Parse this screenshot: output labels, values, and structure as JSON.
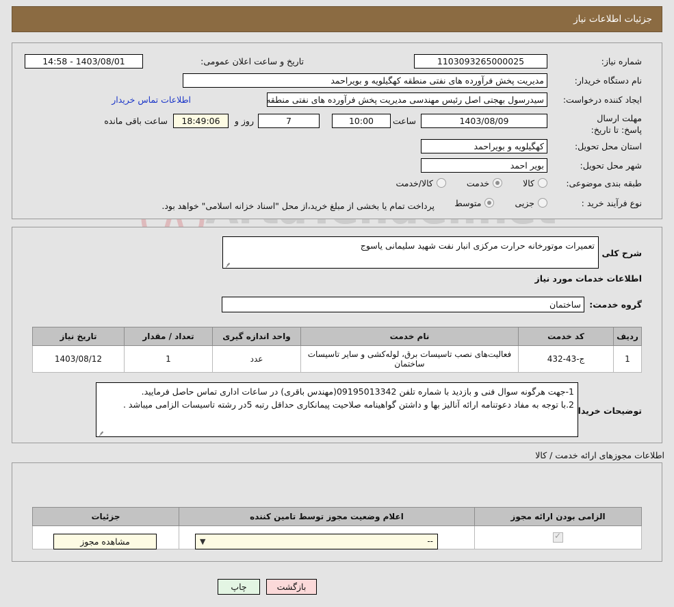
{
  "header": {
    "title": "جزئیات اطلاعات نیاز"
  },
  "watermark": {
    "text": "ArtaTender.net"
  },
  "form": {
    "need_number_label": "شماره نیاز:",
    "need_number_value": "1103093265000025",
    "announce_datetime_label": "تاریخ و ساعت اعلان عمومی:",
    "announce_datetime_value": "1403/08/01 - 14:58",
    "buyer_org_label": "نام دستگاه خریدار:",
    "buyer_org_value": "مدیریت پخش فرآورده های نفتی منطقه کهگیلویه و بویراحمد",
    "requester_label": "ایجاد کننده درخواست:",
    "requester_value": "سیدرسول بهجتی اصل رئیس مهندسی مدیریت پخش فرآورده های نفتی منطقه",
    "contact_link": "اطلاعات تماس خریدار",
    "deadline_label": "مهلت ارسال پاسخ: تا تاریخ:",
    "deadline_date": "1403/08/09",
    "hour_label": "ساعت",
    "deadline_time": "10:00",
    "days_remaining": "7",
    "days_and_label": "روز و",
    "countdown": "18:49:06",
    "remaining_label": "ساعت باقی مانده",
    "province_label": "استان محل تحویل:",
    "province_value": "کهگیلویه و بویراحمد",
    "city_label": "شهر محل تحویل:",
    "city_value": "بویر احمد",
    "category_label": "طبقه بندی موضوعی:",
    "category_options": [
      {
        "label": "کالا",
        "selected": false
      },
      {
        "label": "خدمت",
        "selected": true
      },
      {
        "label": "کالا/خدمت",
        "selected": false
      }
    ],
    "process_label": "نوع فرآیند خرید :",
    "process_options": [
      {
        "label": "جزیی",
        "selected": false
      },
      {
        "label": "متوسط",
        "selected": true
      }
    ],
    "treasury_note": "پرداخت تمام یا بخشی از مبلغ خرید،از محل \"اسناد خزانه اسلامی\" خواهد بود."
  },
  "description": {
    "label": "شرح کلی نیاز:",
    "value": "تعمیرات موتورخانه حرارت مرکزی انبار نفت شهید سلیمانی یاسوج"
  },
  "services": {
    "section_title": "اطلاعات خدمات مورد نیاز",
    "group_label": "گروه خدمت:",
    "group_value": "ساختمان",
    "columns": [
      "ردیف",
      "کد خدمت",
      "نام خدمت",
      "واحد اندازه گیری",
      "تعداد / مقدار",
      "تاریخ نیاز"
    ],
    "rows": [
      {
        "index": "1",
        "code": "ج-43-432",
        "name": "فعالیت‌های نصب تاسیسات برق، لوله‌کشی و سایر تاسیسات ساختمان",
        "unit": "عدد",
        "quantity": "1",
        "date": "1403/08/12"
      }
    ]
  },
  "buyer_notes": {
    "label": "توضیحات خریدار:",
    "lines": [
      "1-جهت هرگونه سوال فنی و بازدید با شماره تلفن 09195013342(مهندس باقری) در ساعات اداری تماس حاصل فرمایید.",
      "2.با توجه به مفاد دعوتنامه ارائه آنالیز بها و داشتن گواهینامه صلاحیت پیمانکاری حداقل رتبه 5در رشته تاسیسات الزامی میباشد ."
    ]
  },
  "permits": {
    "section_title": "اطلاعات مجوزهای ارائه خدمت / کالا",
    "columns": [
      "الزامی بودن ارائه مجوز",
      "اعلام وضعیت مجوز توسط تامین کننده",
      "جزئیات"
    ],
    "rows": [
      {
        "required": true,
        "status": "--",
        "details_button": "مشاهده مجوز"
      }
    ]
  },
  "footer": {
    "print_button": "چاپ",
    "back_button": "بازگشت"
  },
  "colors": {
    "header_bg": "#8b6b42",
    "page_bg": "#e4e4e4",
    "link": "#1a35c8",
    "back_button_bg": "#fbd9d9",
    "print_button_bg": "#e3f5e3",
    "field_highlight_bg": "#fdfbe3"
  }
}
